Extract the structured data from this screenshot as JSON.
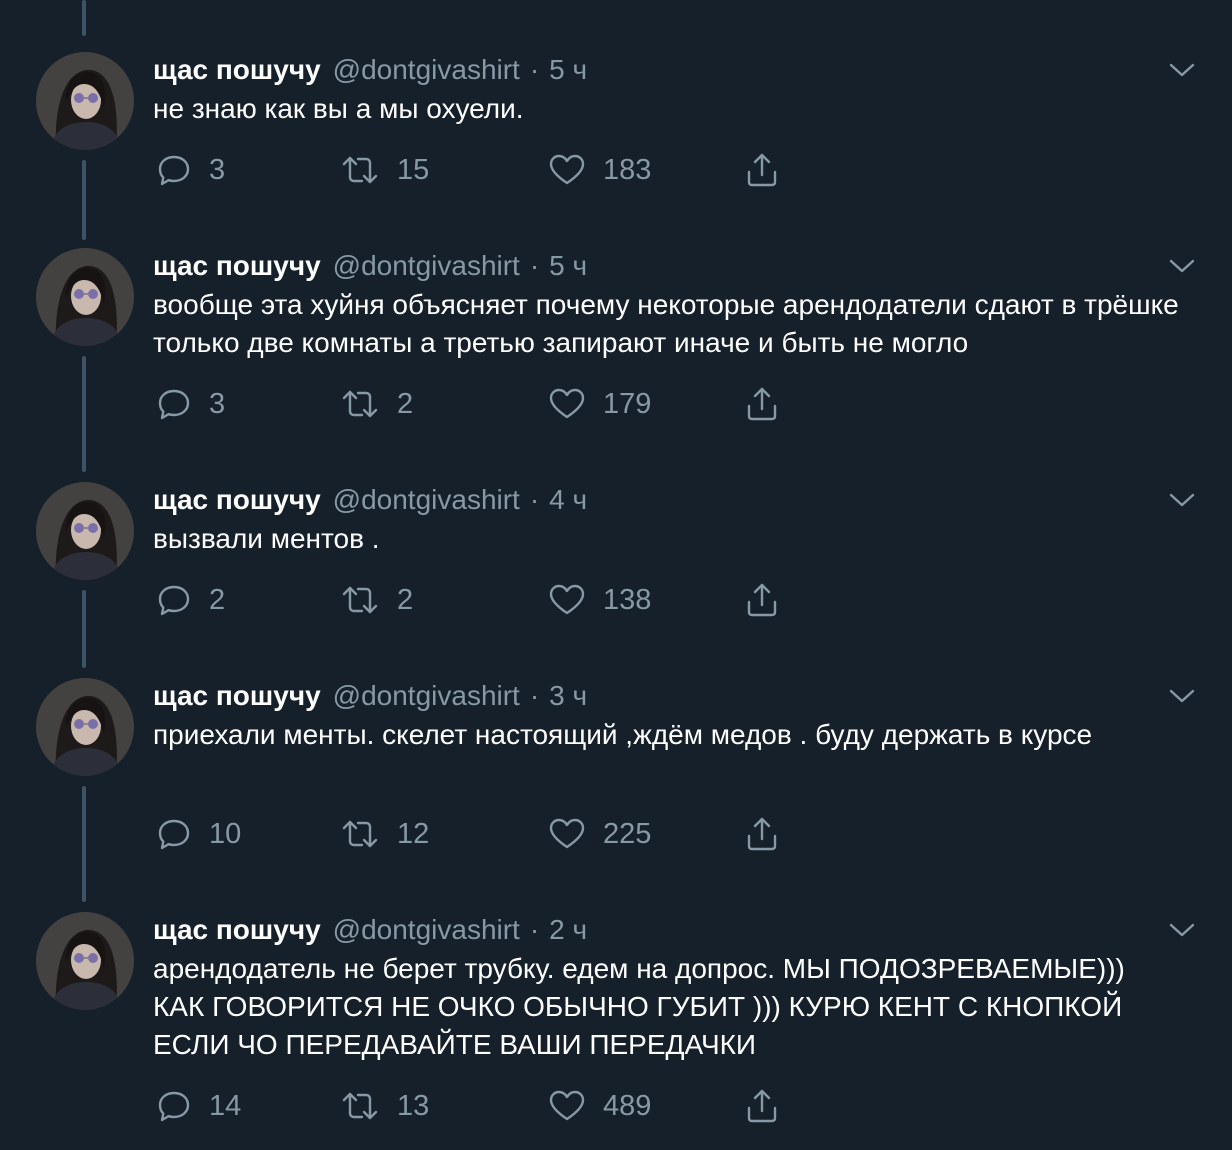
{
  "colors": {
    "background": "#15202b",
    "text": "#ffffff",
    "secondary": "#8899a6",
    "thread_line": "#3d5466"
  },
  "icons": {
    "reply": "reply-icon",
    "retweet": "retweet-icon",
    "like": "like-icon",
    "share": "share-icon",
    "more": "chevron-down-icon"
  },
  "tweets": [
    {
      "name": "щас пошучу",
      "handle": "@dontgivashirt",
      "separator": "·",
      "time": "5 ч",
      "text": "не знаю как вы а мы охуели.",
      "replies": "3",
      "retweets": "15",
      "likes": "183"
    },
    {
      "name": "щас пошучу",
      "handle": "@dontgivashirt",
      "separator": "·",
      "time": "5 ч",
      "text": "вообще эта хуйня объясняет почему некоторые арендодатели сдают в трёшке только две комнаты а третью запирают иначе и быть не могло",
      "replies": "3",
      "retweets": "2",
      "likes": "179"
    },
    {
      "name": "щас пошучу",
      "handle": "@dontgivashirt",
      "separator": "·",
      "time": "4 ч",
      "text": "вызвали ментов .",
      "replies": "2",
      "retweets": "2",
      "likes": "138"
    },
    {
      "name": "щас пошучу",
      "handle": "@dontgivashirt",
      "separator": "·",
      "time": "3 ч",
      "text": "приехали менты. скелет настоящий ,ждём медов . буду держать в курсе",
      "replies": "10",
      "retweets": "12",
      "likes": "225"
    },
    {
      "name": "щас пошучу",
      "handle": "@dontgivashirt",
      "separator": "·",
      "time": "2 ч",
      "text": "арендодатель не берет трубку. едем на допрос. МЫ ПОДОЗРЕВАЕМЫЕ))) КАК ГОВОРИТСЯ НЕ ОЧКО ОБЫЧНО ГУБИТ ))) КУРЮ КЕНТ С КНОПКОЙ ЕСЛИ ЧО ПЕРЕДАВАЙТЕ ВАШИ ПЕРЕДАЧКИ",
      "replies": "14",
      "retweets": "13",
      "likes": "489"
    }
  ]
}
